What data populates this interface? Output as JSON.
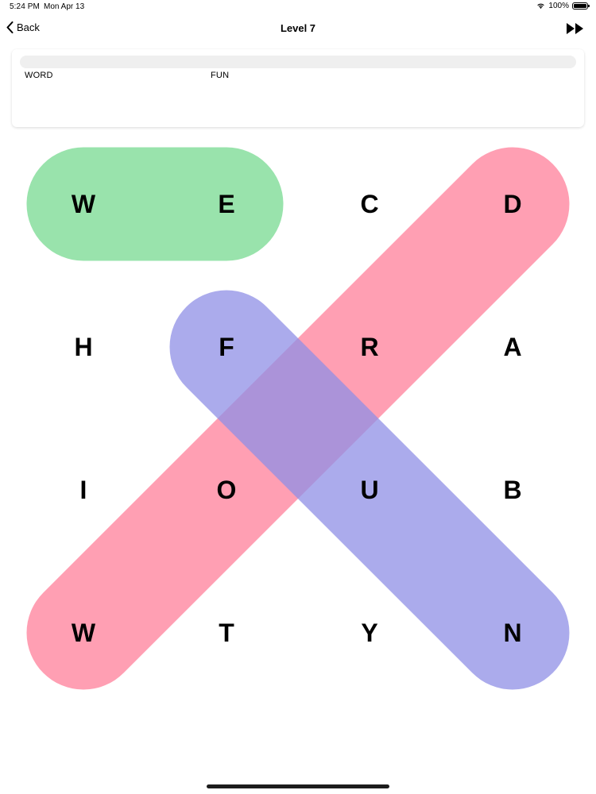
{
  "status_bar": {
    "time": "5:24 PM",
    "date": "Mon Apr 13",
    "battery": "100%",
    "icons": [
      "wifi-icon",
      "battery-icon"
    ]
  },
  "nav": {
    "back_label": "Back",
    "title": "Level 7",
    "skip_icon": "fast-forward-icon"
  },
  "word_panel": {
    "words": [
      "WORD",
      "FUN"
    ],
    "progress": 0
  },
  "grid": {
    "rows": 4,
    "cols": 4,
    "letters": [
      [
        "W",
        "E",
        "C",
        "D"
      ],
      [
        "H",
        "F",
        "R",
        "A"
      ],
      [
        "I",
        "O",
        "U",
        "B"
      ],
      [
        "W",
        "T",
        "Y",
        "N"
      ]
    ]
  },
  "highlights": [
    {
      "name": "found-word-we",
      "from": [
        0,
        0
      ],
      "to": [
        0,
        1
      ],
      "color": "#8ee0a3"
    },
    {
      "name": "found-word-word",
      "from": [
        3,
        0
      ],
      "to": [
        0,
        3
      ],
      "color": "#ff7f9a"
    },
    {
      "name": "found-word-fun",
      "from": [
        1,
        1
      ],
      "to": [
        3,
        3
      ],
      "color": "#8f8fe6"
    }
  ]
}
